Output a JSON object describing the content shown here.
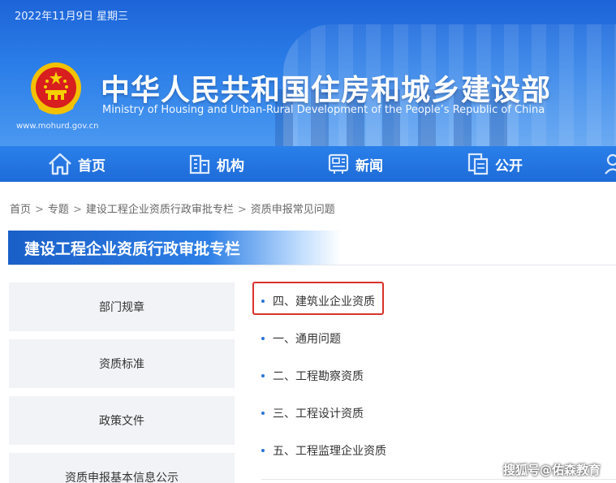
{
  "header": {
    "date": "2022年11月9日 星期三",
    "title": "中华人民共和国住房和城乡建设部",
    "subtitle": "Ministry of Housing and Urban-Rural Development of the People’s Republic of China",
    "url": "www.mohurd.gov.cn",
    "emblem_icon": "national-emblem-icon",
    "colors": {
      "banner": "#2b7ee8",
      "nav": "#1e6bd8"
    }
  },
  "nav": {
    "items": [
      {
        "label": "首页",
        "icon": "home-icon"
      },
      {
        "label": "机构",
        "icon": "building-icon"
      },
      {
        "label": "新闻",
        "icon": "news-icon"
      },
      {
        "label": "公开",
        "icon": "documents-icon"
      }
    ]
  },
  "breadcrumb": {
    "items": [
      "首页",
      "专题",
      "建设工程企业资质行政审批专栏",
      "资质申报常见问题"
    ],
    "separator": ">"
  },
  "section": {
    "title": "建设工程企业资质行政审批专栏"
  },
  "sidebar": {
    "items": [
      {
        "label": "部门规章"
      },
      {
        "label": "资质标准"
      },
      {
        "label": "政策文件"
      },
      {
        "label": "资质申报基本信息公示"
      }
    ]
  },
  "list": {
    "items": [
      {
        "label": "四、建筑业企业资质",
        "highlighted": true
      },
      {
        "label": "一、通用问题"
      },
      {
        "label": "二、工程勘察资质"
      },
      {
        "label": "三、工程设计资质"
      },
      {
        "label": "五、工程监理企业资质"
      }
    ],
    "highlight_color": "#d9322a"
  },
  "watermark": {
    "text": "搜狐号@佑森教育"
  }
}
